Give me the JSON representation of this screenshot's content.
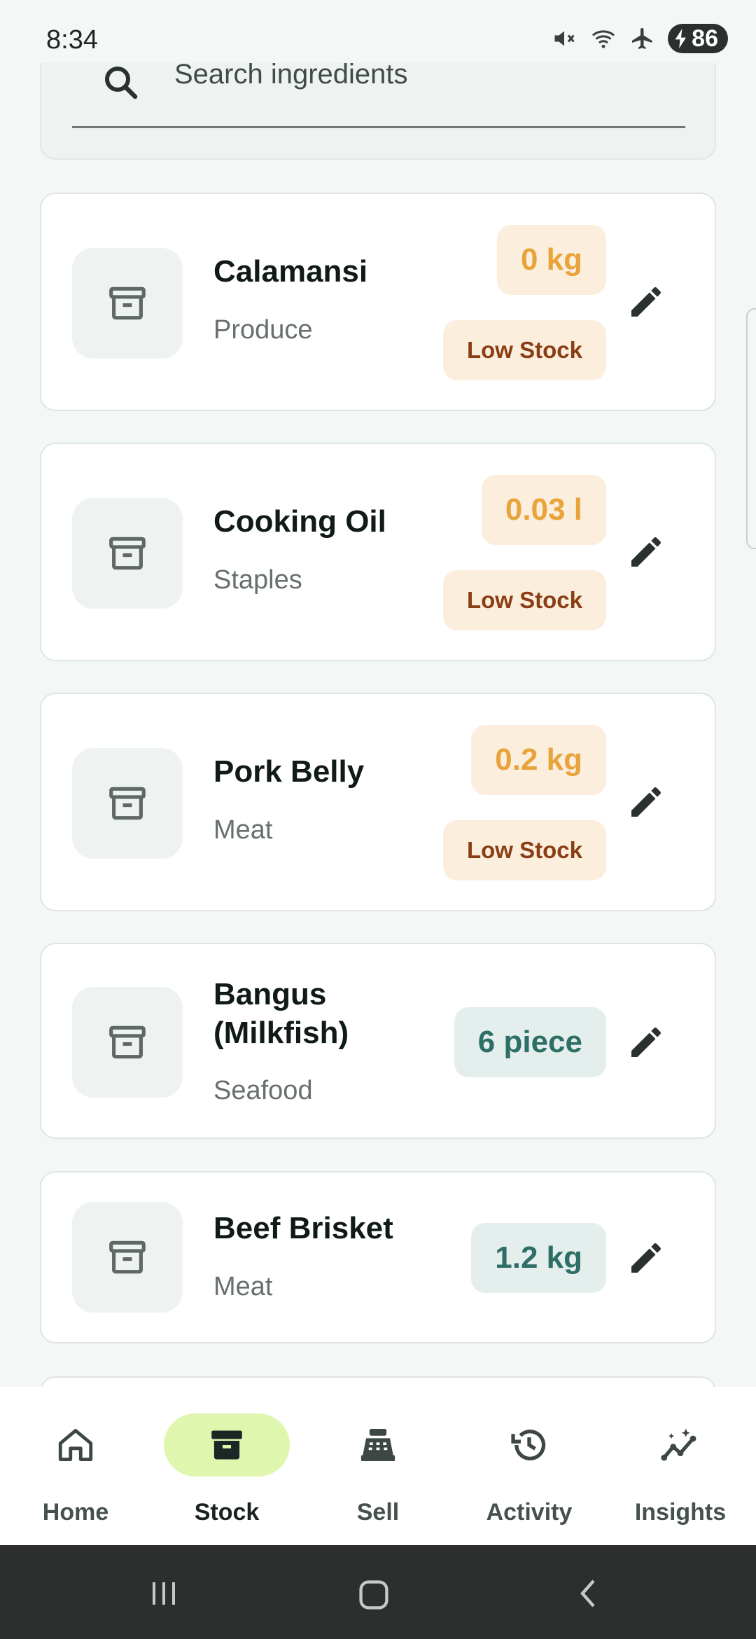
{
  "status_bar": {
    "time": "8:34",
    "battery": "86"
  },
  "search": {
    "placeholder": "Search ingredients"
  },
  "items": [
    {
      "name": "Calamansi",
      "category": "Produce",
      "quantity": "0 kg",
      "badge": "Low Stock",
      "status": "low"
    },
    {
      "name": "Cooking Oil",
      "category": "Staples",
      "quantity": "0.03 l",
      "badge": "Low Stock",
      "status": "low"
    },
    {
      "name": "Pork Belly",
      "category": "Meat",
      "quantity": "0.2 kg",
      "badge": "Low Stock",
      "status": "low"
    },
    {
      "name": "Bangus (Milkfish)",
      "category": "Seafood",
      "quantity": "6 piece",
      "status": "ok"
    },
    {
      "name": "Beef Brisket",
      "category": "Meat",
      "quantity": "1.2 kg",
      "status": "ok"
    }
  ],
  "nav": {
    "items": [
      {
        "label": "Home",
        "icon": "home-icon"
      },
      {
        "label": "Stock",
        "icon": "archive-icon",
        "active": true
      },
      {
        "label": "Sell",
        "icon": "cash-register-icon"
      },
      {
        "label": "Activity",
        "icon": "history-icon"
      },
      {
        "label": "Insights",
        "icon": "insights-icon"
      }
    ]
  },
  "colors": {
    "low_fill": "#fbeedd",
    "low_text": "#e8a43a",
    "badge_text": "#8a3e14",
    "ok_fill": "#e4eeec",
    "ok_text": "#2d6e67",
    "active_nav": "#dff6ae"
  }
}
